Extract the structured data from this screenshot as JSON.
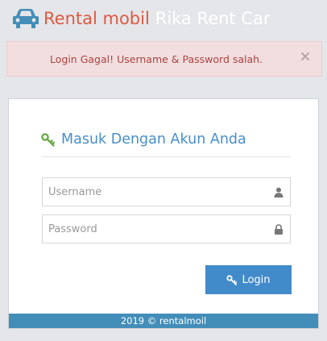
{
  "brand": {
    "name_part1": "Rental mobil",
    "name_part2": "Rika Rent Car",
    "icon": "car-icon"
  },
  "alert": {
    "message": "Login Gagal! Username & Password salah.",
    "close_icon": "close-icon"
  },
  "login_box": {
    "title": "Masuk Dengan Akun Anda",
    "title_icon": "key-icon",
    "username": {
      "placeholder": "Username",
      "value": "",
      "icon": "user-icon"
    },
    "password": {
      "placeholder": "Password",
      "value": "",
      "icon": "lock-icon"
    },
    "login_button": {
      "label": "Login",
      "icon": "key-icon"
    },
    "footer_text": "2019 © rentalmoil"
  },
  "colors": {
    "background": "#e4e6e9",
    "brand_red": "#dd5a43",
    "alert_bg": "#f2dede",
    "alert_text": "#a94442",
    "title_blue": "#478fca",
    "button_blue": "#428bca",
    "footer_blue": "#438eb9"
  }
}
